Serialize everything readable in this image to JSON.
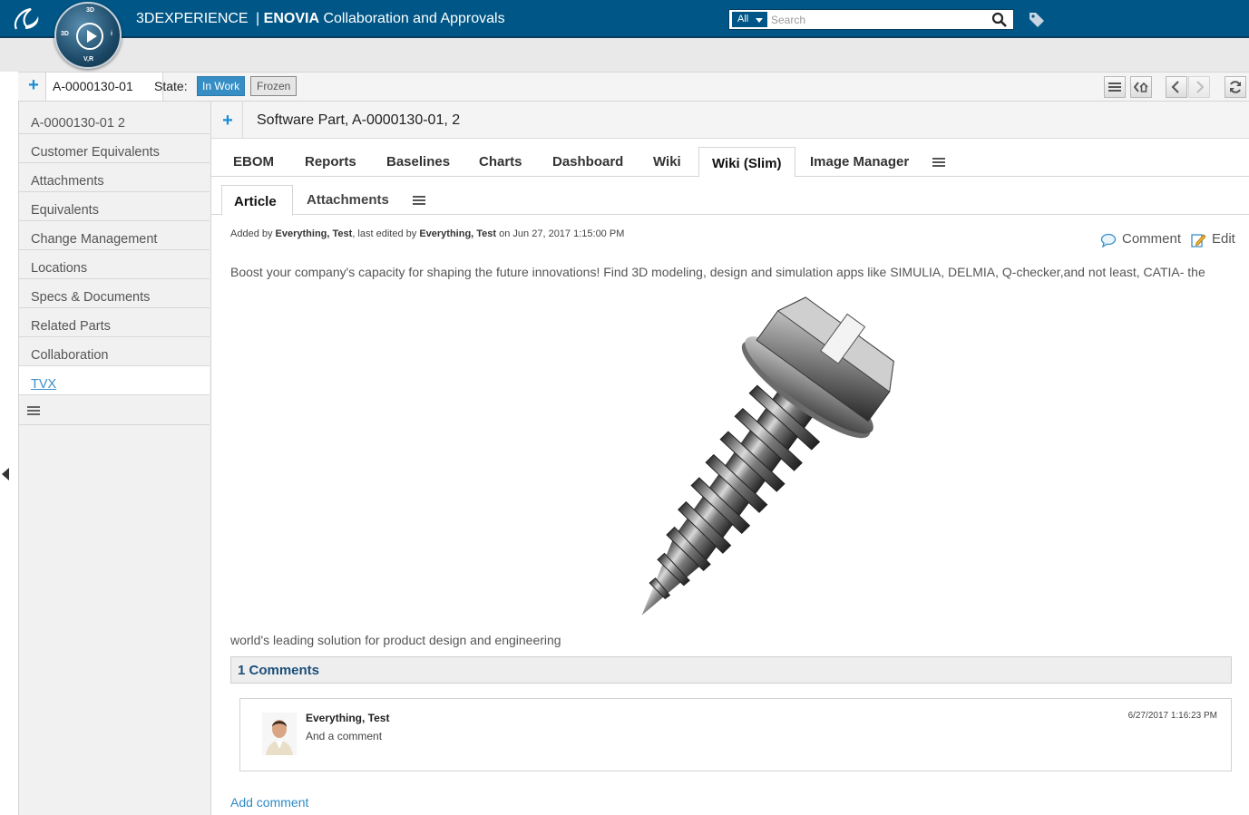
{
  "header": {
    "brand_prefix": "3DEXPERIENCE",
    "brand_app_bold": "ENOVIA",
    "brand_app_rest": "Collaboration and Approvals",
    "compass_labels": {
      "top": "3D",
      "left": "3D",
      "right": "i",
      "bottom": "V,R"
    },
    "search": {
      "scope": "All",
      "placeholder": "Search"
    }
  },
  "object_bar": {
    "name": "A-0000130-01",
    "state_label": "State:",
    "states": [
      {
        "label": "In Work",
        "current": true
      },
      {
        "label": "Frozen",
        "current": false
      }
    ]
  },
  "sidebar": {
    "items": [
      {
        "label": "A-0000130-01 2",
        "active": false
      },
      {
        "label": "Customer Equivalents",
        "active": false
      },
      {
        "label": "Attachments",
        "active": false
      },
      {
        "label": "Equivalents",
        "active": false
      },
      {
        "label": "Change Management",
        "active": false
      },
      {
        "label": "Locations",
        "active": false
      },
      {
        "label": "Specs & Documents",
        "active": false
      },
      {
        "label": "Related Parts",
        "active": false
      },
      {
        "label": "Collaboration",
        "active": false
      },
      {
        "label": "TVX",
        "active": true
      }
    ]
  },
  "main": {
    "title": "Software Part, A-0000130-01, 2",
    "tabs": [
      {
        "label": "EBOM"
      },
      {
        "label": "Reports"
      },
      {
        "label": "Baselines"
      },
      {
        "label": "Charts"
      },
      {
        "label": "Dashboard"
      },
      {
        "label": "Wiki"
      },
      {
        "label": "Wiki (Slim)",
        "active": true
      },
      {
        "label": "Image Manager"
      }
    ],
    "subtabs": [
      {
        "label": "Article",
        "active": true
      },
      {
        "label": "Attachments"
      }
    ]
  },
  "article": {
    "meta": {
      "added_by_label": "Added by",
      "added_by": "Everything, Test",
      "edited_label": ", last edited by",
      "edited_by": "Everything, Test",
      "on_label": "on Jun 27, 2017 1:15:00 PM"
    },
    "actions": {
      "comment": "Comment",
      "edit": "Edit"
    },
    "text_before_image": "Boost your company's capacity for shaping the future innovations! Find 3D modeling, design and simulation apps like SIMULIA, DELMIA, Q-checker,and not least, CATIA- the",
    "text_after_image": "world's leading solution for product design and engineering"
  },
  "comments": {
    "header": "1 Comments",
    "items": [
      {
        "author": "Everything, Test",
        "text": "And a comment",
        "date": "6/27/2017 1:16:23 PM"
      }
    ],
    "add_label": "Add comment"
  },
  "colors": {
    "topbar": "#005686",
    "accent": "#368ec4",
    "link": "#2d8ac6"
  }
}
